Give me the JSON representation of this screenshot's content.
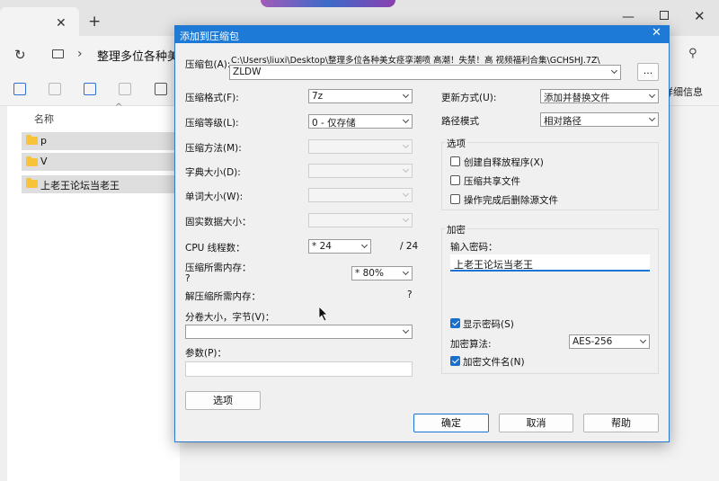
{
  "explorer": {
    "path": "整理多位各种美女",
    "column_name": "名称",
    "details_label": "详细信息",
    "items": [
      "p",
      "V",
      "上老王论坛当老王"
    ]
  },
  "dialog": {
    "title": "添加到压缩包",
    "archive_label": "压缩包(A):",
    "archive_path": "C:\\Users\\liuxi\\Desktop\\整理多位各种美女痉挛潮喷 高潮！失禁！高 视频福利合集\\GCHSHJ.7Z\\",
    "archive_name": "ZLDW",
    "browse_label": "...",
    "format_label": "压缩格式(F):",
    "format_value": "7z",
    "level_label": "压缩等级(L):",
    "level_value": "0 - 仅存储",
    "method_label": "压缩方法(M):",
    "dict_label": "字典大小(D):",
    "word_label": "单词大小(W):",
    "solid_label": "固实数据大小：",
    "cpu_label": "CPU 线程数：",
    "cpu_value": "* 24",
    "cpu_max": "/ 24",
    "mem_label": "压缩所需内存：",
    "mem_sub": "?",
    "mem_value": "* 80%",
    "decomp_label": "解压缩所需内存：",
    "decomp_value": "?",
    "split_label": "分卷大小，字节(V)：",
    "params_label": "参数(P)：",
    "options_button": "选项",
    "update_label": "更新方式(U):",
    "update_value": "添加并替换文件",
    "pathmode_label": "路径模式",
    "pathmode_value": "相对路径",
    "options_group": "选项",
    "opt_sfx": "创建自释放程序(X)",
    "opt_shared": "压缩共享文件",
    "opt_delete": "操作完成后删除源文件",
    "enc_group": "加密",
    "enc_pwd_label": "输入密码：",
    "enc_pwd_value": "上老王论坛当老王",
    "enc_show": "显示密码(S)",
    "enc_method_label": "加密算法:",
    "enc_method_value": "AES-256",
    "enc_names": "加密文件名(N)",
    "ok": "确定",
    "cancel": "取消",
    "help": "帮助"
  },
  "colors": {
    "accent": "#1d7ad6",
    "folder": "#f7c33a"
  }
}
